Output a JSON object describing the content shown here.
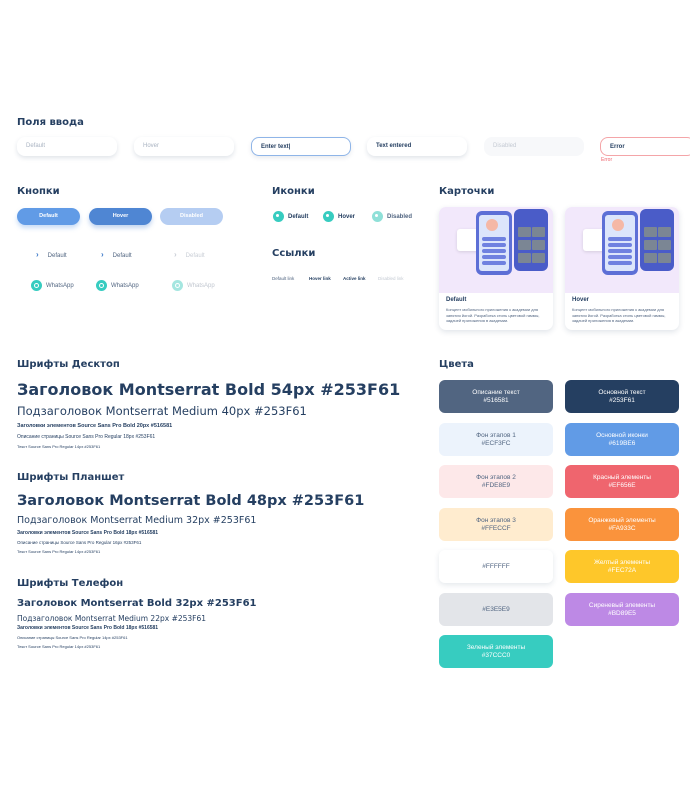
{
  "sections": {
    "inputs": "Поля ввода",
    "buttons": "Кнопки",
    "icons": "Иконки",
    "cards": "Карточки",
    "links": "Ссылки",
    "fonts_desktop": "Шрифты Десктоп",
    "fonts_tablet": "Шрифты Планшет",
    "fonts_phone": "Шрифты Телефон",
    "colors": "Цвета"
  },
  "inputs": {
    "default": "Default",
    "hover": "Hover",
    "focus": "Enter text|",
    "entered": "Text entered",
    "disabled": "Disabled",
    "error": "Error",
    "error_msg": "Error"
  },
  "buttons": {
    "default": "Default",
    "hover": "Hover",
    "disabled": "Disabled",
    "chevron_default": "Default",
    "chevron_hover": "Default",
    "chevron_disabled": "Default",
    "whatsapp_default": "WhatsApp",
    "whatsapp_hover": "WhatsApp",
    "whatsapp_disabled": "WhatsApp"
  },
  "icons": {
    "default": "Default",
    "hover": "Hover",
    "disabled": "Disabled"
  },
  "links": {
    "default": "Default link",
    "hover": "Hover link",
    "active": "Active link",
    "disabled": "Disabled link"
  },
  "cards": [
    {
      "title": "Default",
      "desc": "Концепт мобильного приложения к академии для занятия йогой. Разработка стиль цветовой гаммы, задачей приложения в академии."
    },
    {
      "title": "Hover",
      "desc": "Концепт мобильного приложения к академии для занятия йогой. Разработка стиль цветовой гаммы, задачей приложения в академии."
    }
  ],
  "fonts": {
    "desktop": {
      "h1": "Заголовок Montserrat Bold 54px #253F61",
      "h2": "Подзаголовок Montserrat Medium 40px #253F61",
      "h3": "Заголовки элементов Source Sans Pro Bold 20px #516581",
      "p1": "Описание страницы Source Sans Pro Regular 18px #253F61",
      "p2": "Текст Source Sans Pro Regular 14px #253F61"
    },
    "tablet": {
      "h1": "Заголовок Montserrat Bold 48px #253F61",
      "h2": "Подзаголовок Montserrat Medium 32px #253F61",
      "h3": "Заголовки элементов Source Sans Pro Bold 18px #516581",
      "p1": "Описание страницы Source Sans Pro Regular 16px #253F61",
      "p2": "Текст Source Sans Pro Regular 14px #253F61"
    },
    "phone": {
      "h1": "Заголовок Montserrat Bold 32px #253F61",
      "h2": "Подзаголовок Montserrat Medium 22px #253F61",
      "h3": "Заголовки элементов Source Sans Pro Bold 18px #516581",
      "p1": "Описание страницы Source Sans Pro Regular 14px #253F61",
      "p2": "Текст Source Sans Pro Regular 14px #253F61"
    }
  },
  "colors": [
    {
      "name": "Описание текст",
      "hex": "#516581",
      "bg": "#516581",
      "fg": "#ffffff"
    },
    {
      "name": "Основной текст",
      "hex": "#253F61",
      "bg": "#253F61",
      "fg": "#ffffff"
    },
    {
      "name": "Фон этапов 1",
      "hex": "#ECF3FC",
      "bg": "#ECF3FC",
      "fg": "#516581"
    },
    {
      "name": "Основной иконки",
      "hex": "#619BE6",
      "bg": "#619BE6",
      "fg": "#ffffff"
    },
    {
      "name": "Фон этапов 2",
      "hex": "#FDE8E9",
      "bg": "#FDE8E9",
      "fg": "#516581"
    },
    {
      "name": "Красный элементы",
      "hex": "#EF656E",
      "bg": "#EF656E",
      "fg": "#ffffff"
    },
    {
      "name": "Фон этапов 3",
      "hex": "#FFECCF",
      "bg": "#FFECCF",
      "fg": "#516581"
    },
    {
      "name": "Оранжевый элементы",
      "hex": "#FA933C",
      "bg": "#FA933C",
      "fg": "#ffffff"
    },
    {
      "name": "",
      "hex": "#FFFFFF",
      "bg": "#FFFFFF",
      "fg": "#516581"
    },
    {
      "name": "Желтый элементы",
      "hex": "#FEC72A",
      "bg": "#FEC72A",
      "fg": "#ffffff"
    },
    {
      "name": "",
      "hex": "#E3E5E9",
      "bg": "#E3E5E9",
      "fg": "#516581"
    },
    {
      "name": "Сиреневый элементы",
      "hex": "#BD89E5",
      "bg": "#BD89E5",
      "fg": "#ffffff"
    },
    {
      "name": "Зеленый элементы",
      "hex": "#37CCC0",
      "bg": "#37CCC0",
      "fg": "#ffffff"
    }
  ],
  "palette": {
    "primary_button": "#619BE6",
    "hover_button": "#4F86D3",
    "disabled_button": "#B5CDF2",
    "accent": "#37CCC0",
    "error": "#EF656E"
  }
}
